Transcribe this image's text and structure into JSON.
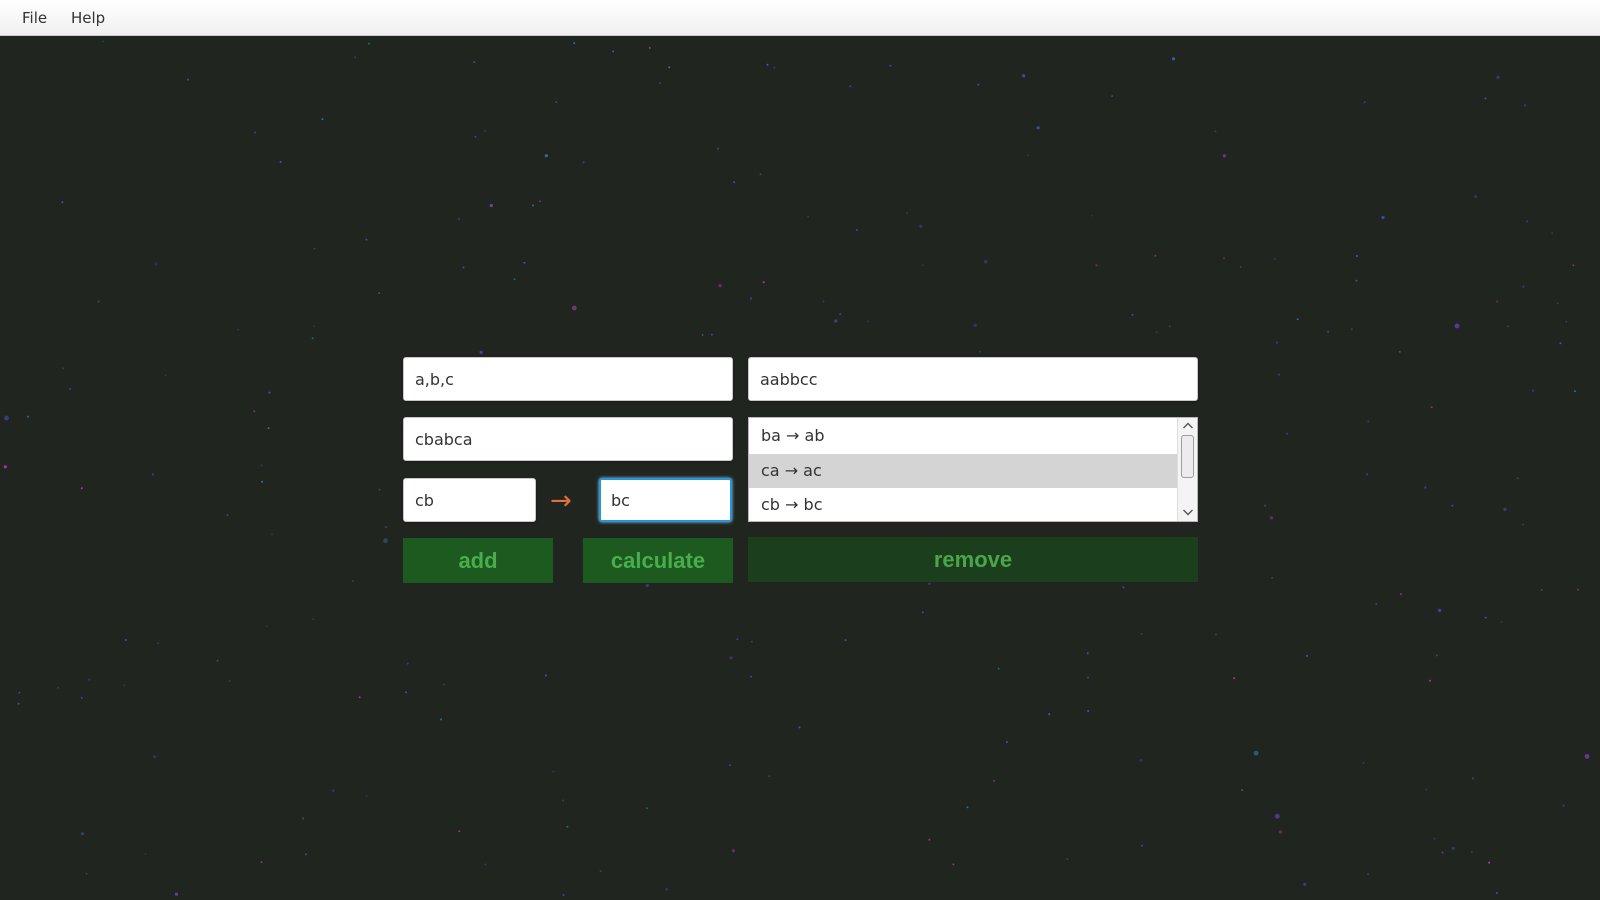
{
  "menubar": {
    "items": [
      {
        "label": "File"
      },
      {
        "label": "Help"
      }
    ]
  },
  "form": {
    "alphabet_value": "a,b,c",
    "input_word_value": "cbabca",
    "rule_from_value": "cb",
    "rule_to_value": "bc",
    "result_value": "aabbcc",
    "arrow_glyph": "→",
    "rules": [
      {
        "label": "ba → ab",
        "selected": false
      },
      {
        "label": "ca → ac",
        "selected": true
      },
      {
        "label": "cb → bc",
        "selected": false
      }
    ]
  },
  "buttons": {
    "add_label": "add",
    "calculate_label": "calculate",
    "remove_label": "remove"
  },
  "colors": {
    "background": "#21251f",
    "button_bg": "#1c5a1f",
    "button_text": "#4aad4c",
    "remove_bg": "#1b3f1c",
    "arrow": "#e2703f",
    "focus_border": "#2596d9",
    "selected_row": "#d4d4d4"
  },
  "icons": {
    "scroll_up": "chevron-up-icon",
    "scroll_down": "chevron-down-icon",
    "rule_arrow": "right-arrow-icon"
  }
}
